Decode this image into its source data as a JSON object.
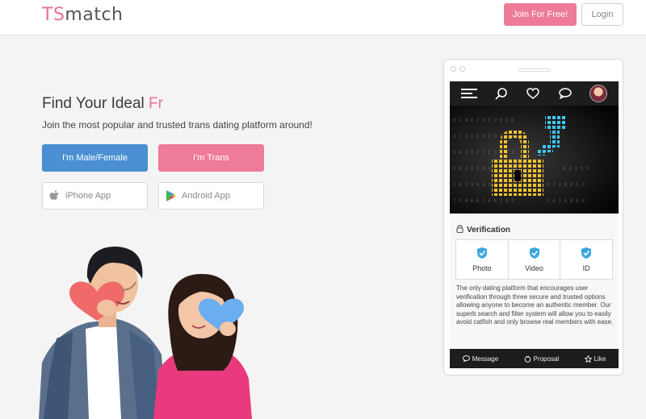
{
  "header": {
    "logo_ts": "TS",
    "logo_rest": "match",
    "join_label": "Join For Free!",
    "login_label": "Login"
  },
  "hero": {
    "headline_main": "Find Your Ideal ",
    "headline_accent": "Fr",
    "subline": "Join the most popular and trusted trans dating platform around!",
    "male_button": "I'm Male/Female",
    "trans_button": "I'm Trans",
    "iphone_button": "iPhone App",
    "android_button": "Android App"
  },
  "phone": {
    "verification_title": "Verification",
    "verification_items": [
      "Photo",
      "Video",
      "ID"
    ],
    "description": "The only dating platform that encourages user verification through three secure and trusted options allowing anyone to become an authentic member. Our superb search and filter system will allow you to easily avoid catfish and only browse real members with ease.",
    "footer": {
      "message": "Message",
      "proposal": "Proposal",
      "like": "Like"
    }
  },
  "colors": {
    "pink": "#ee7b97",
    "blue": "#4a90d2",
    "verify_blue": "#3aa6dd"
  },
  "icons": [
    "apple-icon",
    "google-play-icon",
    "menu-icon",
    "search-icon",
    "heart-icon",
    "chat-icon",
    "lock-icon",
    "shield-check-icon",
    "message-icon",
    "proposal-icon",
    "star-icon"
  ]
}
